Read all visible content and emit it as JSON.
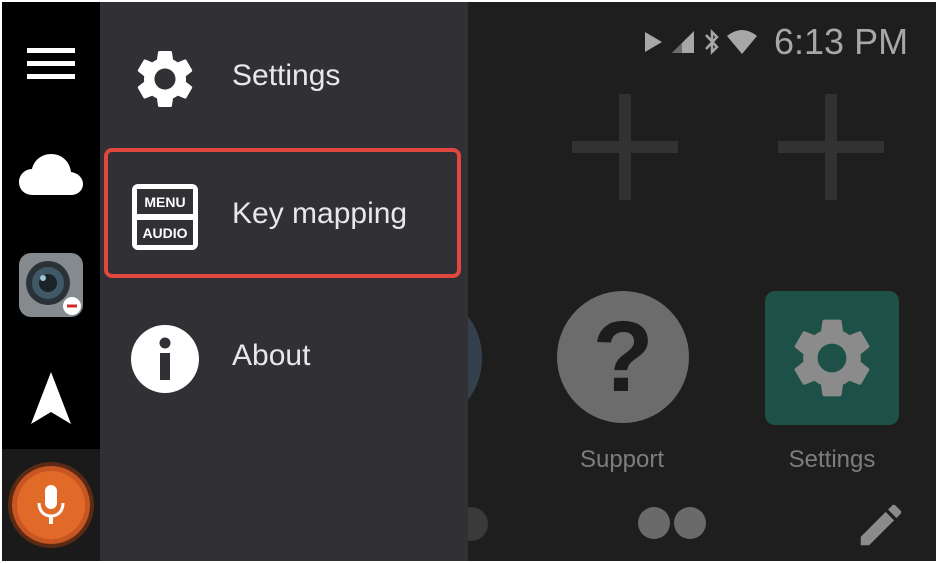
{
  "status_bar": {
    "time": "6:13 PM",
    "icons": [
      "play-icon",
      "signal-icon",
      "bluetooth-icon",
      "wifi-icon"
    ]
  },
  "rail": {
    "items": [
      "menu-icon",
      "cloud-icon",
      "camera-app-icon",
      "navigation-icon",
      "microphone-icon"
    ],
    "mic_color": "#e16a28"
  },
  "drawer": {
    "items": [
      {
        "label": "Settings",
        "icon": "gear-icon"
      },
      {
        "label": "Key mapping",
        "icon": "key-mapping-icon",
        "icon_text_top": "MENU",
        "icon_text_bottom": "AUDIO",
        "highlighted": true
      },
      {
        "label": "About",
        "icon": "info-icon"
      }
    ],
    "highlight_color": "#e0473f"
  },
  "home": {
    "apps": [
      {
        "label": "Support",
        "icon": "question-icon"
      },
      {
        "label": "Settings",
        "icon": "gear-icon"
      }
    ],
    "question_glyph": "?",
    "settings_tile_color": "#1d5046"
  }
}
